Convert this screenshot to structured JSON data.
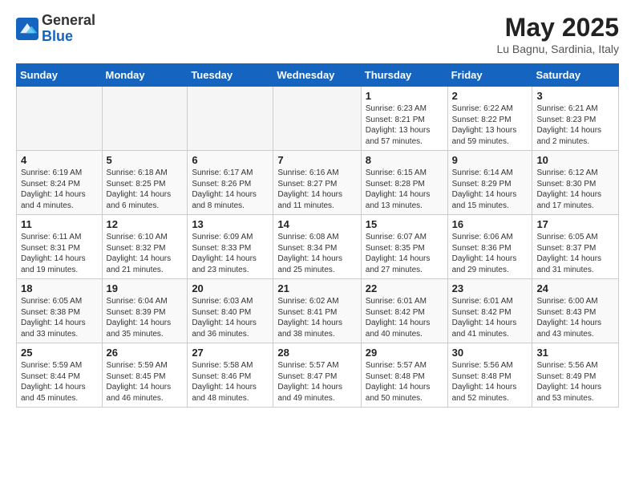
{
  "logo": {
    "general": "General",
    "blue": "Blue"
  },
  "header": {
    "month": "May 2025",
    "location": "Lu Bagnu, Sardinia, Italy"
  },
  "days": [
    "Sunday",
    "Monday",
    "Tuesday",
    "Wednesday",
    "Thursday",
    "Friday",
    "Saturday"
  ],
  "weeks": [
    [
      {
        "day": "",
        "empty": true
      },
      {
        "day": "",
        "empty": true
      },
      {
        "day": "",
        "empty": true
      },
      {
        "day": "",
        "empty": true
      },
      {
        "day": "1",
        "sunrise": "Sunrise: 6:23 AM",
        "sunset": "Sunset: 8:21 PM",
        "daylight": "Daylight: 13 hours and 57 minutes."
      },
      {
        "day": "2",
        "sunrise": "Sunrise: 6:22 AM",
        "sunset": "Sunset: 8:22 PM",
        "daylight": "Daylight: 13 hours and 59 minutes."
      },
      {
        "day": "3",
        "sunrise": "Sunrise: 6:21 AM",
        "sunset": "Sunset: 8:23 PM",
        "daylight": "Daylight: 14 hours and 2 minutes."
      }
    ],
    [
      {
        "day": "4",
        "sunrise": "Sunrise: 6:19 AM",
        "sunset": "Sunset: 8:24 PM",
        "daylight": "Daylight: 14 hours and 4 minutes."
      },
      {
        "day": "5",
        "sunrise": "Sunrise: 6:18 AM",
        "sunset": "Sunset: 8:25 PM",
        "daylight": "Daylight: 14 hours and 6 minutes."
      },
      {
        "day": "6",
        "sunrise": "Sunrise: 6:17 AM",
        "sunset": "Sunset: 8:26 PM",
        "daylight": "Daylight: 14 hours and 8 minutes."
      },
      {
        "day": "7",
        "sunrise": "Sunrise: 6:16 AM",
        "sunset": "Sunset: 8:27 PM",
        "daylight": "Daylight: 14 hours and 11 minutes."
      },
      {
        "day": "8",
        "sunrise": "Sunrise: 6:15 AM",
        "sunset": "Sunset: 8:28 PM",
        "daylight": "Daylight: 14 hours and 13 minutes."
      },
      {
        "day": "9",
        "sunrise": "Sunrise: 6:14 AM",
        "sunset": "Sunset: 8:29 PM",
        "daylight": "Daylight: 14 hours and 15 minutes."
      },
      {
        "day": "10",
        "sunrise": "Sunrise: 6:12 AM",
        "sunset": "Sunset: 8:30 PM",
        "daylight": "Daylight: 14 hours and 17 minutes."
      }
    ],
    [
      {
        "day": "11",
        "sunrise": "Sunrise: 6:11 AM",
        "sunset": "Sunset: 8:31 PM",
        "daylight": "Daylight: 14 hours and 19 minutes."
      },
      {
        "day": "12",
        "sunrise": "Sunrise: 6:10 AM",
        "sunset": "Sunset: 8:32 PM",
        "daylight": "Daylight: 14 hours and 21 minutes."
      },
      {
        "day": "13",
        "sunrise": "Sunrise: 6:09 AM",
        "sunset": "Sunset: 8:33 PM",
        "daylight": "Daylight: 14 hours and 23 minutes."
      },
      {
        "day": "14",
        "sunrise": "Sunrise: 6:08 AM",
        "sunset": "Sunset: 8:34 PM",
        "daylight": "Daylight: 14 hours and 25 minutes."
      },
      {
        "day": "15",
        "sunrise": "Sunrise: 6:07 AM",
        "sunset": "Sunset: 8:35 PM",
        "daylight": "Daylight: 14 hours and 27 minutes."
      },
      {
        "day": "16",
        "sunrise": "Sunrise: 6:06 AM",
        "sunset": "Sunset: 8:36 PM",
        "daylight": "Daylight: 14 hours and 29 minutes."
      },
      {
        "day": "17",
        "sunrise": "Sunrise: 6:05 AM",
        "sunset": "Sunset: 8:37 PM",
        "daylight": "Daylight: 14 hours and 31 minutes."
      }
    ],
    [
      {
        "day": "18",
        "sunrise": "Sunrise: 6:05 AM",
        "sunset": "Sunset: 8:38 PM",
        "daylight": "Daylight: 14 hours and 33 minutes."
      },
      {
        "day": "19",
        "sunrise": "Sunrise: 6:04 AM",
        "sunset": "Sunset: 8:39 PM",
        "daylight": "Daylight: 14 hours and 35 minutes."
      },
      {
        "day": "20",
        "sunrise": "Sunrise: 6:03 AM",
        "sunset": "Sunset: 8:40 PM",
        "daylight": "Daylight: 14 hours and 36 minutes."
      },
      {
        "day": "21",
        "sunrise": "Sunrise: 6:02 AM",
        "sunset": "Sunset: 8:41 PM",
        "daylight": "Daylight: 14 hours and 38 minutes."
      },
      {
        "day": "22",
        "sunrise": "Sunrise: 6:01 AM",
        "sunset": "Sunset: 8:42 PM",
        "daylight": "Daylight: 14 hours and 40 minutes."
      },
      {
        "day": "23",
        "sunrise": "Sunrise: 6:01 AM",
        "sunset": "Sunset: 8:42 PM",
        "daylight": "Daylight: 14 hours and 41 minutes."
      },
      {
        "day": "24",
        "sunrise": "Sunrise: 6:00 AM",
        "sunset": "Sunset: 8:43 PM",
        "daylight": "Daylight: 14 hours and 43 minutes."
      }
    ],
    [
      {
        "day": "25",
        "sunrise": "Sunrise: 5:59 AM",
        "sunset": "Sunset: 8:44 PM",
        "daylight": "Daylight: 14 hours and 45 minutes."
      },
      {
        "day": "26",
        "sunrise": "Sunrise: 5:59 AM",
        "sunset": "Sunset: 8:45 PM",
        "daylight": "Daylight: 14 hours and 46 minutes."
      },
      {
        "day": "27",
        "sunrise": "Sunrise: 5:58 AM",
        "sunset": "Sunset: 8:46 PM",
        "daylight": "Daylight: 14 hours and 48 minutes."
      },
      {
        "day": "28",
        "sunrise": "Sunrise: 5:57 AM",
        "sunset": "Sunset: 8:47 PM",
        "daylight": "Daylight: 14 hours and 49 minutes."
      },
      {
        "day": "29",
        "sunrise": "Sunrise: 5:57 AM",
        "sunset": "Sunset: 8:48 PM",
        "daylight": "Daylight: 14 hours and 50 minutes."
      },
      {
        "day": "30",
        "sunrise": "Sunrise: 5:56 AM",
        "sunset": "Sunset: 8:48 PM",
        "daylight": "Daylight: 14 hours and 52 minutes."
      },
      {
        "day": "31",
        "sunrise": "Sunrise: 5:56 AM",
        "sunset": "Sunset: 8:49 PM",
        "daylight": "Daylight: 14 hours and 53 minutes."
      }
    ]
  ]
}
